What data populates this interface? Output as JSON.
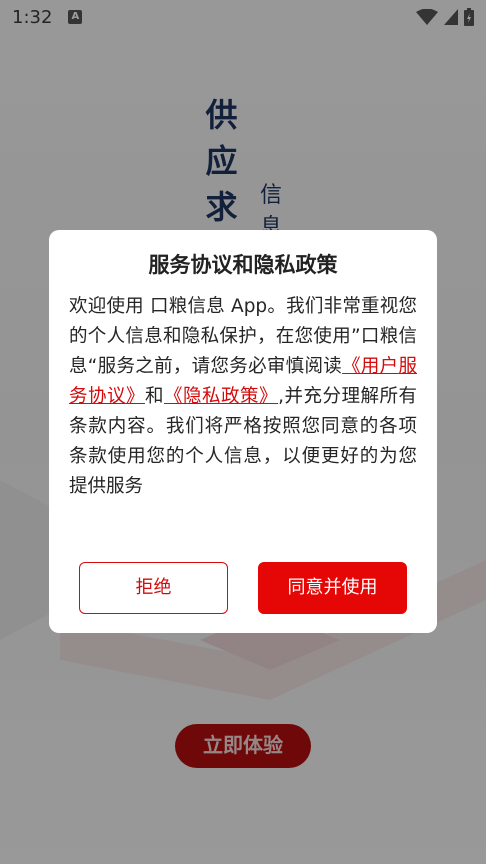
{
  "status_bar": {
    "time": "1:32",
    "notification_glyph": "A",
    "icons": [
      "wifi-icon",
      "signal-icon",
      "battery-charging-icon"
    ]
  },
  "splash": {
    "title_chars": [
      "供",
      "应",
      "求"
    ],
    "subtitle_chars": [
      "信",
      "息"
    ],
    "start_button": "立即体验"
  },
  "dialog": {
    "title": "服务协议和隐私政策",
    "body_part1": "欢迎使用 口粮信息 App。我们非常重视您的个人信息和隐私保护，在您使用”口粮信息“服务之前，请您务必审慎阅读",
    "link_user_agreement": "《用户服务协议》",
    "body_and": "和",
    "link_privacy": "《隐私政策》",
    "body_part2": ",并充分理解所有条款内容。我们将严格按照您同意的各项条款使用您的个人信息，以便更好的为您提供服务",
    "reject_label": "拒绝",
    "agree_label": "同意并使用"
  },
  "colors": {
    "accent_red": "#e50606",
    "link_red": "#d40b0b",
    "splash_navy": "#1f3561"
  }
}
